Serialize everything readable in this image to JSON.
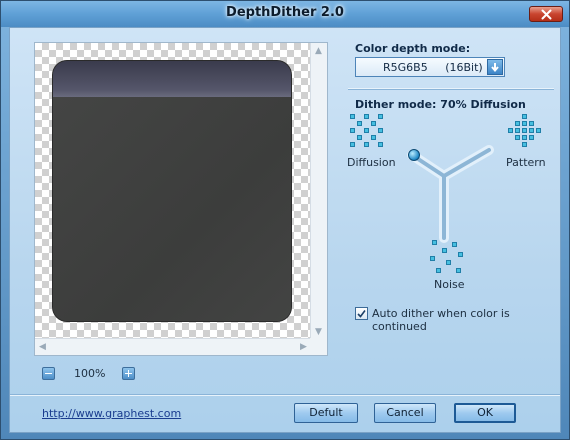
{
  "window": {
    "title": "DepthDither 2.0"
  },
  "colors": {
    "accent": "#4d8fc8",
    "close": "#c9452f"
  },
  "color_depth": {
    "label": "Color depth mode:",
    "selected": "R5G6B5     (16Bit)"
  },
  "dither": {
    "label": "Dither mode: 70% Diffusion",
    "modes": {
      "diffusion": "Diffusion",
      "pattern": "Pattern",
      "noise": "Noise"
    }
  },
  "auto_dither": {
    "label": "Auto dither when color is continued",
    "checked": true
  },
  "zoom": {
    "level": "100%"
  },
  "footer": {
    "link": "http://www.graphest.com",
    "default_label": "Defult",
    "cancel_label": "Cancel",
    "ok_label": "OK"
  }
}
